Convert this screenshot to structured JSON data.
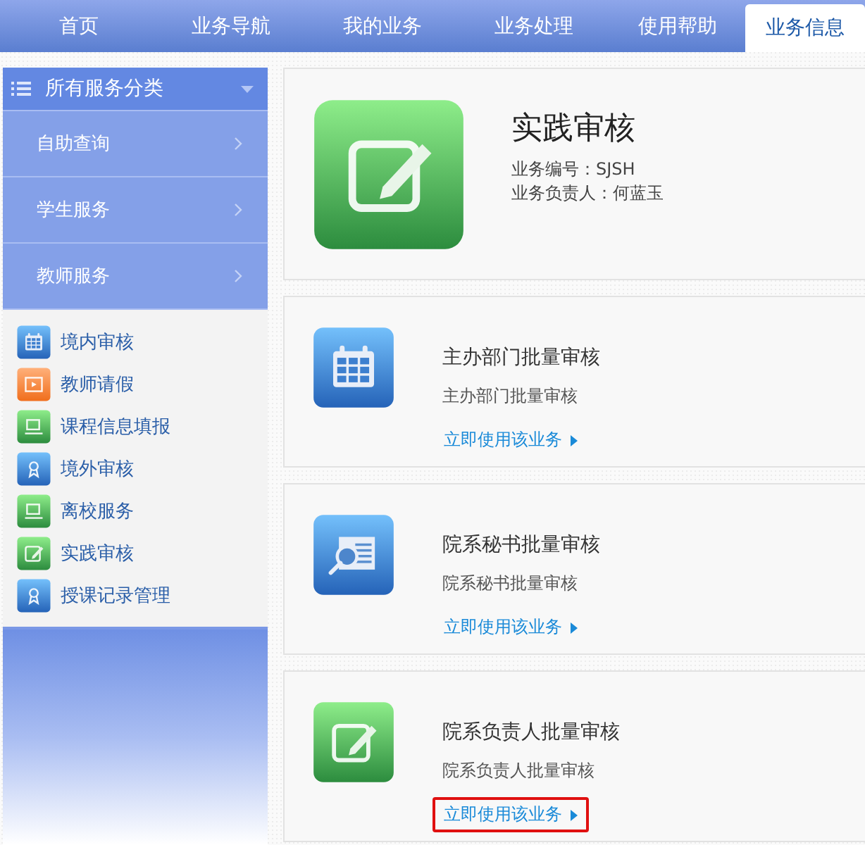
{
  "nav": {
    "tabs": [
      {
        "label": "首页",
        "selected": false
      },
      {
        "label": "业务导航",
        "selected": false
      },
      {
        "label": "我的业务",
        "selected": false
      },
      {
        "label": "业务处理",
        "selected": false
      },
      {
        "label": "使用帮助",
        "selected": false
      },
      {
        "label": "业务信息",
        "selected": true
      }
    ]
  },
  "sidebar": {
    "header": {
      "label": "所有服务分类",
      "expanded": true
    },
    "categories": [
      {
        "label": "自助查询"
      },
      {
        "label": "学生服务"
      },
      {
        "label": "教师服务"
      }
    ],
    "services": [
      {
        "label": "境内审核",
        "kind": "calendar"
      },
      {
        "label": "教师请假",
        "kind": "video"
      },
      {
        "label": "课程信息填报",
        "kind": "laptop"
      },
      {
        "label": "境外审核",
        "kind": "award"
      },
      {
        "label": "离校服务",
        "kind": "laptop"
      },
      {
        "label": "实践审核",
        "kind": "edit"
      },
      {
        "label": "授课记录管理",
        "kind": "award"
      }
    ]
  },
  "detail": {
    "title": "实践审核",
    "kind": "edit",
    "code": "业务编号：SJSH",
    "owner": "业务负责人：何蓝玉"
  },
  "cards": [
    {
      "title": "主办部门批量审核",
      "kind": "calendar",
      "subtitle": "主办部门批量审核",
      "link": "立即使用该业务",
      "highlighted": false
    },
    {
      "title": "院系秘书批量审核",
      "kind": "doc-search",
      "subtitle": "院系秘书批量审核",
      "link": "立即使用该业务",
      "highlighted": false
    },
    {
      "title": "院系负责人批量审核",
      "kind": "edit",
      "subtitle": "院系负责人批量审核",
      "link": "立即使用该业务",
      "highlighted": true
    }
  ]
}
